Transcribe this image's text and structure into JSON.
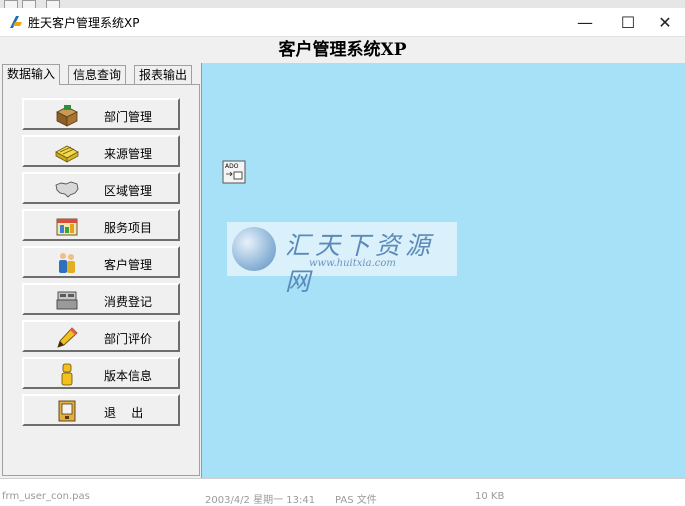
{
  "window": {
    "title": "胜天客户管理系统XP",
    "minimize_glyph": "—",
    "maximize_glyph": "☐",
    "close_glyph": "✕"
  },
  "app": {
    "heading": "客户管理系统XP"
  },
  "tabs": [
    {
      "label": "数据输入",
      "active": true
    },
    {
      "label": "信息查询",
      "active": false
    },
    {
      "label": "报表输出",
      "active": false
    }
  ],
  "nav_buttons": [
    {
      "label": "部门管理",
      "icon": "desk-icon"
    },
    {
      "label": "来源管理",
      "icon": "scanner-icon"
    },
    {
      "label": "区域管理",
      "icon": "map-icon"
    },
    {
      "label": "服务项目",
      "icon": "notebook-icon"
    },
    {
      "label": "客户管理",
      "icon": "people-icon"
    },
    {
      "label": "消费登记",
      "icon": "cash-register-icon"
    },
    {
      "label": "部门评价",
      "icon": "pencil-icon"
    },
    {
      "label": "版本信息",
      "icon": "info-icon"
    },
    {
      "label": "退    出",
      "icon": "exit-door-icon"
    }
  ],
  "main": {
    "ado_icon_label": "ADO",
    "watermark_text": "汇天下资源网",
    "watermark_url": "www.huitxia.com"
  },
  "status_strip": {
    "file": "frm_user_con.pas",
    "date": "2003/4/2 星期一 13:41",
    "type": "PAS 文件",
    "size": "10 KB"
  },
  "colors": {
    "main_background": "#a6e1f8",
    "panel_background": "#f0f0f0"
  }
}
